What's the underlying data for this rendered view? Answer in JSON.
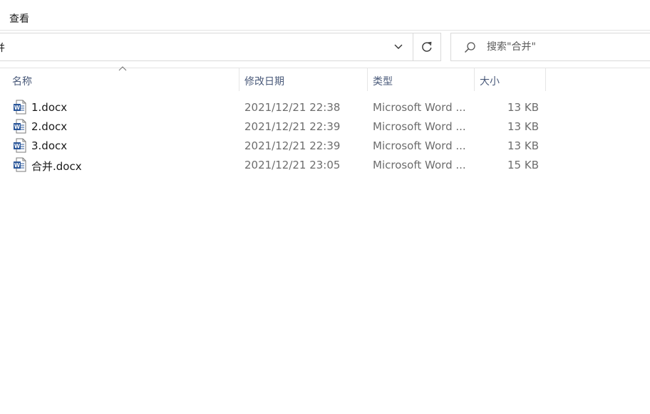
{
  "ribbon": {
    "tab_view": "查看"
  },
  "address": {
    "current_folder": "并"
  },
  "search": {
    "placeholder": "搜索\"合并\""
  },
  "columns": {
    "name": "名称",
    "date_modified": "修改日期",
    "type": "类型",
    "size": "大小"
  },
  "files": [
    {
      "name": "1.docx",
      "date": "2021/12/21 22:38",
      "type": "Microsoft Word ...",
      "size": "13 KB",
      "icon": "word-document-icon"
    },
    {
      "name": "2.docx",
      "date": "2021/12/21 22:39",
      "type": "Microsoft Word ...",
      "size": "13 KB",
      "icon": "word-document-icon"
    },
    {
      "name": "3.docx",
      "date": "2021/12/21 22:39",
      "type": "Microsoft Word ...",
      "size": "13 KB",
      "icon": "word-document-icon"
    },
    {
      "name": "合并.docx",
      "date": "2021/12/21 23:05",
      "type": "Microsoft Word ...",
      "size": "15 KB",
      "icon": "word-document-icon"
    }
  ],
  "colors": {
    "word_blue": "#2b579a",
    "header_text": "#4a5a7a",
    "secondary_text": "#6d6d6d"
  }
}
